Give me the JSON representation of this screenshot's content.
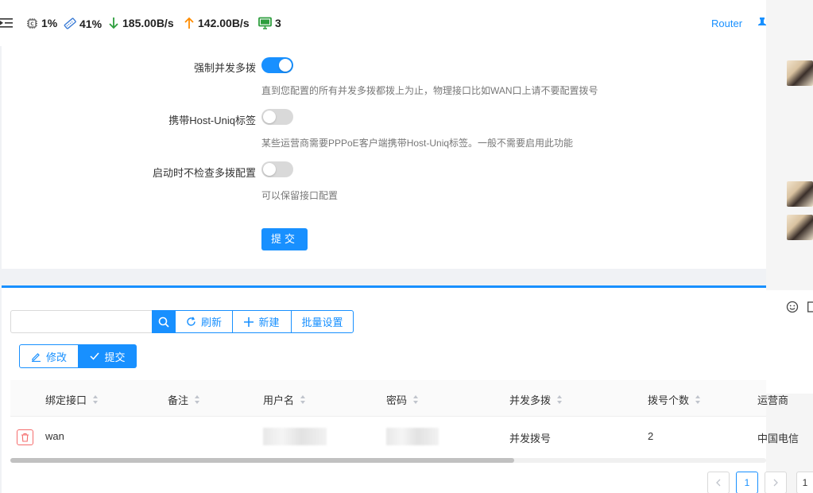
{
  "topbar": {
    "stats": [
      {
        "icon": "cpu-icon",
        "value": "1%"
      },
      {
        "icon": "memory-icon",
        "value": "41%"
      },
      {
        "icon": "download-arrow-icon",
        "value": "185.00B/s",
        "color": "#2e9e3e"
      },
      {
        "icon": "upload-arrow-icon",
        "value": "142.00B/s",
        "color": "#ff8c00"
      },
      {
        "icon": "monitor-icon",
        "value": "3",
        "color": "#2e9e3e"
      }
    ],
    "router_label": "Router"
  },
  "settings": {
    "force_concurrent": {
      "label": "强制并发多拨",
      "enabled": true,
      "help": "直到您配置的所有并发多拨都拨上为止，物理接口比如WAN口上请不要配置拨号"
    },
    "host_uniq": {
      "label": "携带Host-Uniq标签",
      "enabled": false,
      "help": "某些运营商需要PPPoE客户端携带Host-Uniq标签。一般不需要启用此功能"
    },
    "skip_check": {
      "label": "启动时不检查多拨配置",
      "enabled": false,
      "help": "可以保留接口配置"
    },
    "submit_label": "提交"
  },
  "toolbar": {
    "search_placeholder": "",
    "refresh_label": "刷新",
    "new_label": "新建",
    "batch_label": "批量设置",
    "edit_label": "修改",
    "commit_label": "提交"
  },
  "table": {
    "columns": [
      "绑定接口",
      "备注",
      "用户名",
      "密码",
      "并发多拨",
      "拨号个数",
      "运营商"
    ],
    "rows": [
      {
        "interface": "wan",
        "note": "",
        "username": "",
        "password": "",
        "mode": "并发拨号",
        "count": "2",
        "isp": "中国电信"
      }
    ]
  },
  "pagination": {
    "current": "1",
    "next_label": "1"
  },
  "colors": {
    "accent": "#1890ff",
    "danger": "#f56c6c"
  }
}
